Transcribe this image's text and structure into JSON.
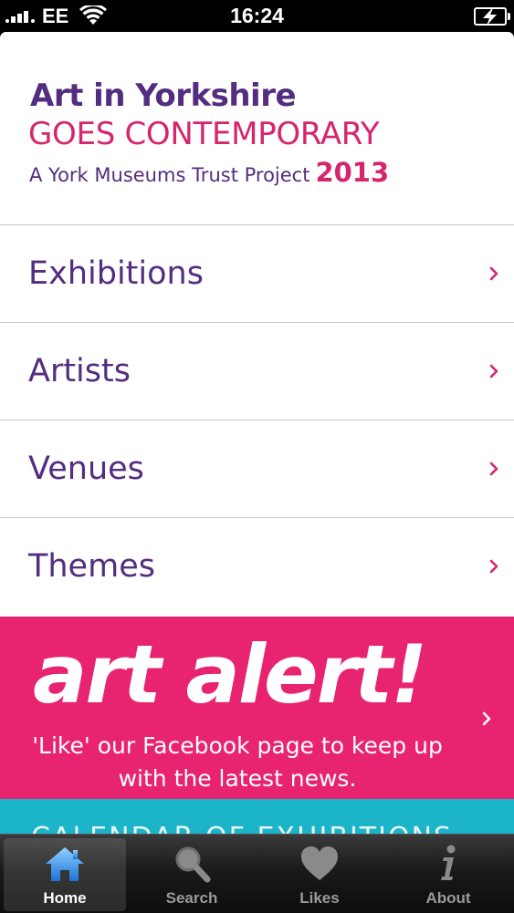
{
  "status": {
    "carrier": "EE",
    "time": "16:24"
  },
  "logo": {
    "line1": "Art in Yorkshire",
    "line2": "GOES CONTEMPORARY",
    "line3": "A York Museums Trust Project",
    "year": "2013"
  },
  "menu": {
    "items": [
      {
        "label": "Exhibitions"
      },
      {
        "label": "Artists"
      },
      {
        "label": "Venues"
      },
      {
        "label": "Themes"
      }
    ]
  },
  "alert": {
    "title": "art alert!",
    "text_line1": "'Like' our Facebook page to keep up",
    "text_line2": "with the latest news."
  },
  "calendar": {
    "text": "CALENDAR OF EXHIBITIONS"
  },
  "tabs": [
    {
      "label": "Home",
      "icon": "home-icon",
      "active": true
    },
    {
      "label": "Search",
      "icon": "search-icon",
      "active": false
    },
    {
      "label": "Likes",
      "icon": "heart-icon",
      "active": false
    },
    {
      "label": "About",
      "icon": "info-icon",
      "active": false
    }
  ],
  "colors": {
    "purple": "#532d7f",
    "pink": "#d6256f",
    "alert_pink": "#e8236f",
    "calendar_teal": "#1cb4c8"
  }
}
